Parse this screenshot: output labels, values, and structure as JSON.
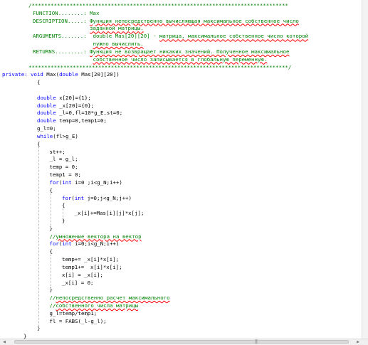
{
  "editor": {
    "lines": [
      {
        "indent": 0,
        "segments": [
          {
            "t": "/*********************************************************************************",
            "c": "cmt"
          }
        ]
      },
      {
        "indent": 0,
        "segments": [
          {
            "t": "FUNCTION........: Max",
            "c": "cmt"
          }
        ]
      },
      {
        "indent": 0,
        "segments": [
          {
            "t": "DESCRIPTION.....: ",
            "c": "cmt"
          },
          {
            "t": "Функция непосредственно вычисляющая максимальное собственное число",
            "c": "cmt",
            "sq": true
          }
        ]
      },
      {
        "indent": 0,
        "segments": [
          {
            "t": "                  ",
            "c": "cmt"
          },
          {
            "t": "заданной матрицы.",
            "c": "cmt",
            "sq": true
          }
        ]
      },
      {
        "indent": 0,
        "segments": [
          {
            "t": "ARGUMENTS.......:  double Mas[20][20] - ",
            "c": "cmt"
          },
          {
            "t": "матрица, максимальное собственное число которой",
            "c": "cmt",
            "sq": true
          }
        ]
      },
      {
        "indent": 0,
        "segments": [
          {
            "t": "                   ",
            "c": "cmt"
          },
          {
            "t": "нужно вычислить.",
            "c": "cmt",
            "sq": true
          }
        ]
      },
      {
        "indent": 0,
        "segments": [
          {
            "t": "RETURNS.........: ",
            "c": "cmt"
          },
          {
            "t": "Функция не возвращает никаких значений. Полученное максимальное",
            "c": "cmt",
            "sq": true
          }
        ]
      },
      {
        "indent": 0,
        "segments": [
          {
            "t": "                   ",
            "c": "cmt"
          },
          {
            "t": "собственное число записывается в глобальную переменную.",
            "c": "cmt",
            "sq": true
          }
        ]
      },
      {
        "indent": 0,
        "segments": [
          {
            "t": "**********************************************************************************/",
            "c": "cmt"
          }
        ]
      },
      {
        "indent": 0,
        "segments": [
          {
            "t": "private: ",
            "c": "kw"
          },
          {
            "t": "void",
            "c": "kw"
          },
          {
            "t": " Max(",
            "c": "txt"
          },
          {
            "t": "double",
            "c": "kw"
          },
          {
            "t": " Mas[20][20])",
            "c": "txt"
          }
        ]
      },
      {
        "indent": 0,
        "segments": [
          {
            "t": "{",
            "c": "txt"
          }
        ]
      },
      {
        "indent": 0,
        "segments": [
          {
            "t": "",
            "c": "txt"
          }
        ]
      },
      {
        "indent": 0,
        "segments": [
          {
            "t": "double",
            "c": "kw"
          },
          {
            "t": " x[20]={1};",
            "c": "txt"
          }
        ]
      },
      {
        "indent": 0,
        "segments": [
          {
            "t": "double",
            "c": "kw"
          },
          {
            "t": " _x[20]={0};",
            "c": "txt"
          }
        ]
      },
      {
        "indent": 0,
        "segments": [
          {
            "t": "double",
            "c": "kw"
          },
          {
            "t": " _l=0,fl=10*g_E,st=0;",
            "c": "txt"
          }
        ]
      },
      {
        "indent": 0,
        "segments": [
          {
            "t": "double",
            "c": "kw"
          },
          {
            "t": " temp=0,temp1=0;",
            "c": "txt"
          }
        ]
      },
      {
        "indent": 0,
        "segments": [
          {
            "t": "g_l=0;",
            "c": "txt"
          }
        ]
      },
      {
        "indent": 0,
        "segments": [
          {
            "t": "while",
            "c": "kw"
          },
          {
            "t": "(fl>g_E)",
            "c": "txt"
          }
        ]
      },
      {
        "indent": 0,
        "segments": [
          {
            "t": "{",
            "c": "txt"
          }
        ]
      },
      {
        "indent": 1,
        "segments": [
          {
            "t": "st++;",
            "c": "txt"
          }
        ]
      },
      {
        "indent": 1,
        "segments": [
          {
            "t": "_l = g_l;",
            "c": "txt"
          }
        ]
      },
      {
        "indent": 1,
        "segments": [
          {
            "t": "temp = 0;",
            "c": "txt"
          }
        ]
      },
      {
        "indent": 1,
        "segments": [
          {
            "t": "temp1 = 0;",
            "c": "txt"
          }
        ]
      },
      {
        "indent": 1,
        "segments": [
          {
            "t": "for",
            "c": "kw"
          },
          {
            "t": "(",
            "c": "txt"
          },
          {
            "t": "int",
            "c": "kw"
          },
          {
            "t": " i=0 ;i<g_N;i++)",
            "c": "txt"
          }
        ]
      },
      {
        "indent": 1,
        "segments": [
          {
            "t": "{",
            "c": "txt"
          }
        ]
      },
      {
        "indent": 2,
        "segments": [
          {
            "t": "for",
            "c": "kw"
          },
          {
            "t": "(",
            "c": "txt"
          },
          {
            "t": "int",
            "c": "kw"
          },
          {
            "t": " j=0;j<g_N;j++)",
            "c": "txt"
          }
        ]
      },
      {
        "indent": 2,
        "segments": [
          {
            "t": "{",
            "c": "txt"
          }
        ]
      },
      {
        "indent": 3,
        "segments": [
          {
            "t": "_x[i]+=Mas[i][j]*x[j];",
            "c": "txt"
          }
        ]
      },
      {
        "indent": 2,
        "segments": [
          {
            "t": "}",
            "c": "txt"
          }
        ]
      },
      {
        "indent": 1,
        "segments": [
          {
            "t": "}",
            "c": "txt"
          }
        ]
      },
      {
        "indent": 1,
        "segments": [
          {
            "t": "//",
            "c": "cmt"
          },
          {
            "t": "умножение вектора на вектор",
            "c": "cmt",
            "sq": true
          }
        ]
      },
      {
        "indent": 1,
        "segments": [
          {
            "t": "for",
            "c": "kw"
          },
          {
            "t": "(",
            "c": "txt"
          },
          {
            "t": "int",
            "c": "kw"
          },
          {
            "t": " i=0;i<g_N;i++)",
            "c": "txt"
          }
        ]
      },
      {
        "indent": 1,
        "segments": [
          {
            "t": "{",
            "c": "txt"
          }
        ]
      },
      {
        "indent": 2,
        "segments": [
          {
            "t": "temp+= _x[i]*x[i];",
            "c": "txt"
          }
        ]
      },
      {
        "indent": 2,
        "segments": [
          {
            "t": "temp1+=  x[i]*x[i];",
            "c": "txt"
          }
        ]
      },
      {
        "indent": 2,
        "segments": [
          {
            "t": "x[i] = _x[i];",
            "c": "txt"
          }
        ]
      },
      {
        "indent": 2,
        "segments": [
          {
            "t": "_x[i] = 0;",
            "c": "txt"
          }
        ]
      },
      {
        "indent": 1,
        "segments": [
          {
            "t": "}",
            "c": "txt"
          }
        ]
      },
      {
        "indent": 1,
        "segments": [
          {
            "t": "//",
            "c": "cmt"
          },
          {
            "t": "непосредственно расчет максимального",
            "c": "cmt",
            "sq": true
          }
        ]
      },
      {
        "indent": 1,
        "segments": [
          {
            "t": "//",
            "c": "cmt"
          },
          {
            "t": "собственного числа матрицы",
            "c": "cmt",
            "sq": true
          }
        ]
      },
      {
        "indent": 1,
        "segments": [
          {
            "t": "g_l=temp/temp1;",
            "c": "txt"
          }
        ]
      },
      {
        "indent": 1,
        "segments": [
          {
            "t": "fl = FABS(_l-g_l);",
            "c": "txt"
          }
        ]
      },
      {
        "indent": 0,
        "segments": [
          {
            "t": "}",
            "c": "txt"
          }
        ]
      },
      {
        "indent": -1,
        "segments": [
          {
            "t": "}",
            "c": "txt"
          }
        ]
      }
    ]
  },
  "colors": {
    "comment": "#008000",
    "keyword": "#0000ff",
    "text": "#000000",
    "squiggle": "#ff0000"
  },
  "scrollbar": {
    "grip_label": "|||"
  }
}
